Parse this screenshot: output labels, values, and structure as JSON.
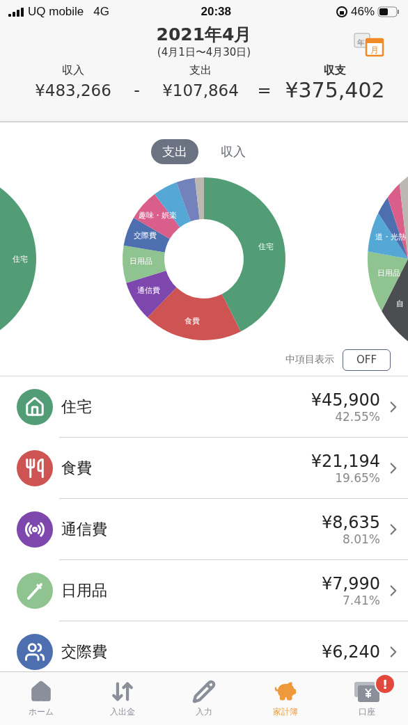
{
  "status_bar": {
    "carrier": "UQ mobile",
    "network": "4G",
    "time": "20:38",
    "battery": "46%"
  },
  "header": {
    "title": "2021年4月",
    "range": "(4月1日〜4月30日)",
    "calendar_icon": {
      "back": "年",
      "front": "月"
    }
  },
  "summary": {
    "income_label": "収入",
    "income": "¥483,266",
    "minus": "-",
    "expense_label": "支出",
    "expense": "¥107,864",
    "equals": "=",
    "balance_label": "収支",
    "balance": "¥375,402"
  },
  "tabs": [
    {
      "label": "支出",
      "selected": true
    },
    {
      "label": "収入",
      "selected": false
    }
  ],
  "left_chart": {
    "labels": [
      "住宅"
    ]
  },
  "chart_data": {
    "type": "donut",
    "categories": [
      "住宅",
      "食費",
      "通信費",
      "日用品",
      "交際費",
      "趣味・娯楽",
      null,
      null,
      null
    ],
    "values": [
      42.55,
      19.65,
      8.01,
      7.41,
      5.79,
      6.2,
      4.9,
      3.7,
      1.79
    ],
    "colors": [
      "#529d75",
      "#cd5452",
      "#7e47ae",
      "#8fc38f",
      "#4d6fb0",
      "#da5e8a",
      "#55a7d6",
      "#7382bb",
      "#bcb8b1"
    ]
  },
  "right_chart": {
    "labels": [
      "道・光熱",
      "日用品",
      "自"
    ]
  },
  "sub_items": {
    "label": "中項目表示",
    "toggle": "OFF",
    "on": false
  },
  "categories": [
    {
      "kind": "home",
      "name": "住宅",
      "amount": "¥45,900",
      "percent": "42.55%",
      "color": "#529d75"
    },
    {
      "kind": "food",
      "name": "食費",
      "amount": "¥21,194",
      "percent": "19.65%",
      "color": "#cd5452"
    },
    {
      "kind": "phone",
      "name": "通信費",
      "amount": "¥8,635",
      "percent": "8.01%",
      "color": "#7e47ae"
    },
    {
      "kind": "daily",
      "name": "日用品",
      "amount": "¥7,990",
      "percent": "7.41%",
      "color": "#8fc38f"
    },
    {
      "kind": "social",
      "name": "交際費",
      "amount": "¥6,240",
      "color": "#4d6fb0"
    }
  ],
  "tab_bar": [
    {
      "kind": "home",
      "label": "ホーム",
      "selected": false
    },
    {
      "kind": "transfer",
      "label": "入出金",
      "selected": false
    },
    {
      "kind": "input",
      "label": "入力",
      "selected": false
    },
    {
      "kind": "budget",
      "label": "家計簿",
      "selected": true
    },
    {
      "kind": "account",
      "label": "口座",
      "selected": false,
      "badge": "!"
    }
  ]
}
